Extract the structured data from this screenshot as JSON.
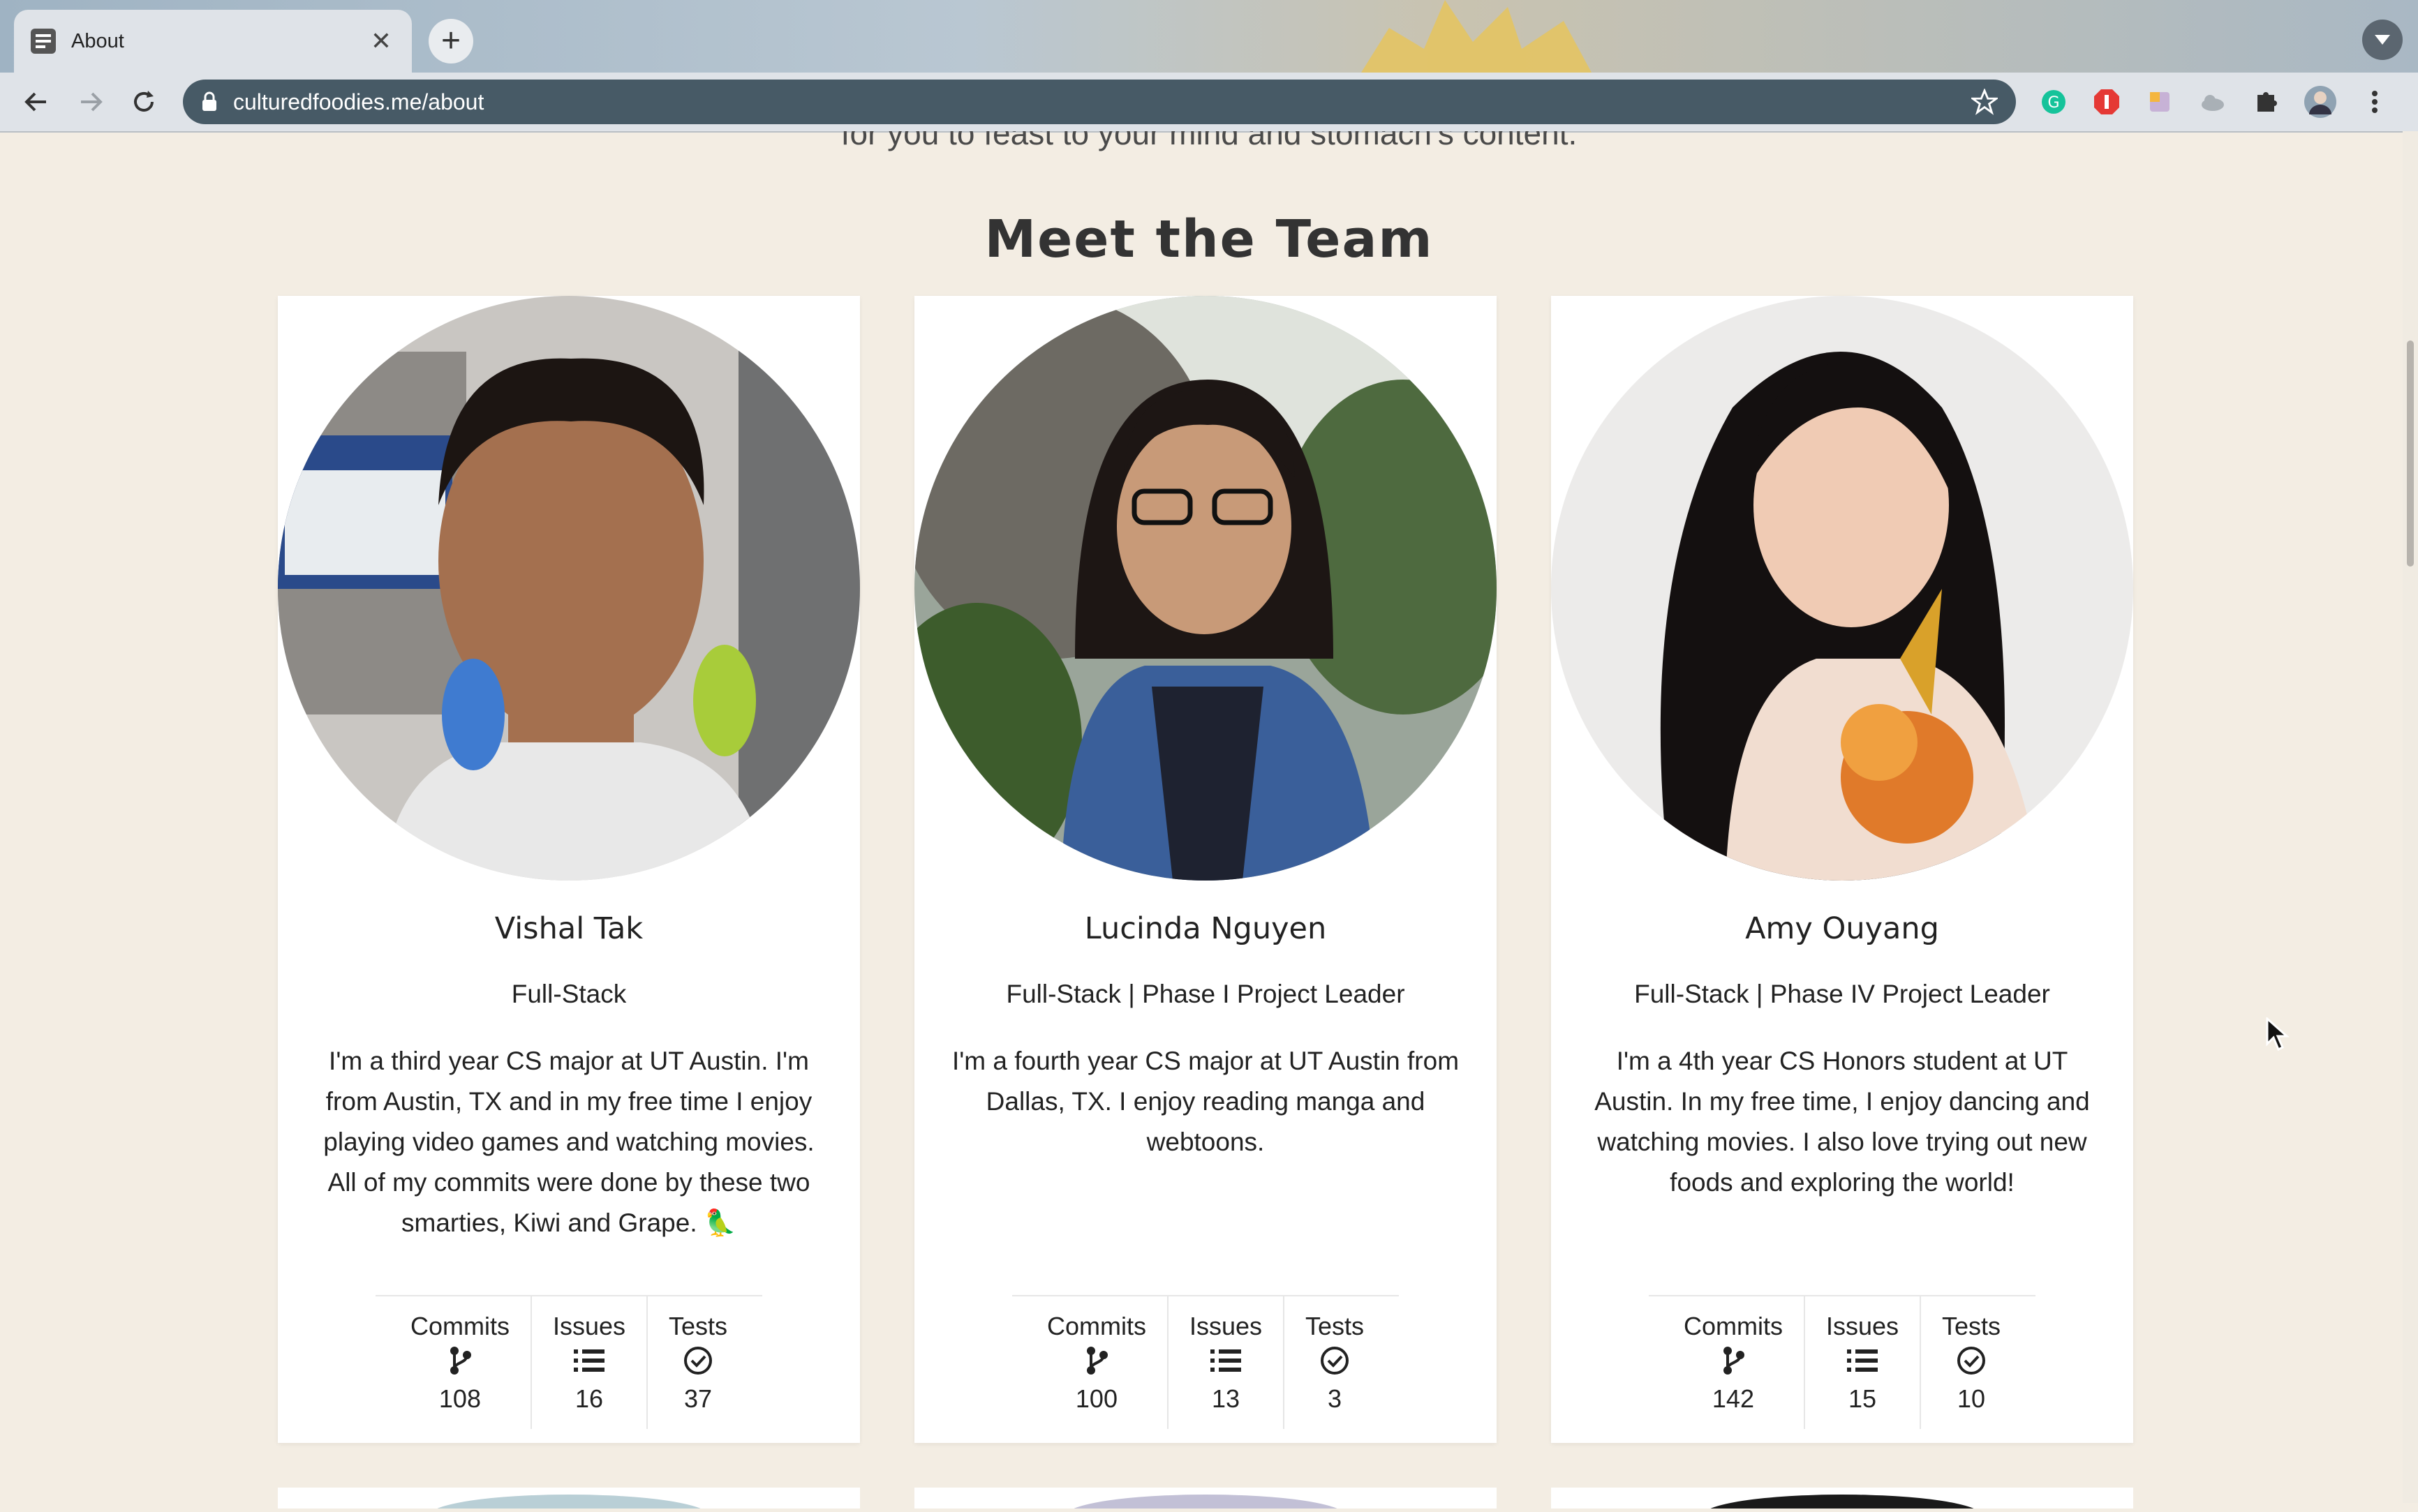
{
  "browser": {
    "tab_title": "About",
    "url": "culturedfoodies.me/about"
  },
  "page": {
    "cut_off_text": "for you to feast to your mind and stomach's content.",
    "section_title": "Meet the Team",
    "stat_labels": {
      "commits": "Commits",
      "issues": "Issues",
      "tests": "Tests"
    }
  },
  "team": [
    {
      "name": "Vishal Tak",
      "role": "Full-Stack",
      "bio": "I'm a third year CS major at UT Austin. I'm from Austin, TX and in my free time I enjoy playing video games and watching movies. All of my commits were done by these two smarties, Kiwi and Grape. 🦜",
      "commits": "108",
      "issues": "16",
      "tests": "37"
    },
    {
      "name": "Lucinda Nguyen",
      "role": "Full-Stack | Phase I Project Leader",
      "bio": "I'm a fourth year CS major at UT Austin from Dallas, TX. I enjoy reading manga and webtoons.",
      "commits": "100",
      "issues": "13",
      "tests": "3"
    },
    {
      "name": "Amy Ouyang",
      "role": "Full-Stack | Phase IV Project Leader",
      "bio": "I'm a 4th year CS Honors student at UT Austin. In my free time, I enjoy dancing and watching movies. I also love trying out new foods and exploring the world!",
      "commits": "142",
      "issues": "15",
      "tests": "10"
    }
  ],
  "icons": {
    "commits": "git-branch-icon",
    "issues": "list-icon",
    "tests": "check-circle-icon"
  },
  "colors": {
    "page_background": "#f3ede3",
    "card_background": "#ffffff",
    "omnibox": "#475a66"
  }
}
